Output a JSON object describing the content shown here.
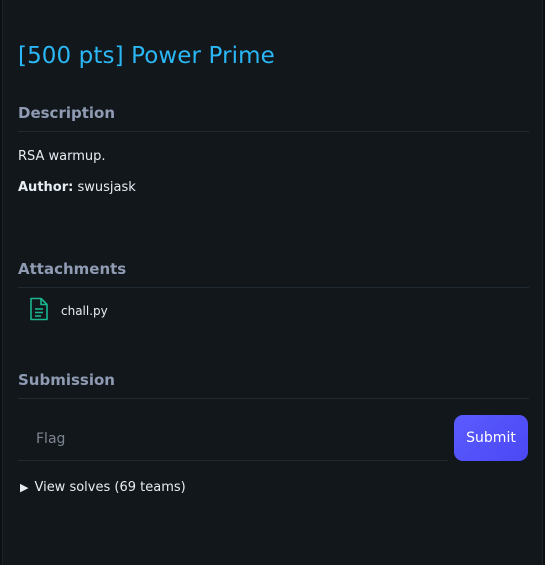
{
  "challenge": {
    "title": "[500 pts] Power Prime",
    "description": "RSA warmup.",
    "author_label": "Author:",
    "author_name": "swusjask"
  },
  "sections": {
    "description": "Description",
    "attachments": "Attachments",
    "submission": "Submission"
  },
  "attachments": [
    {
      "name": "chall.py",
      "icon": "file-document-icon"
    }
  ],
  "submission": {
    "input_placeholder": "Flag",
    "submit_label": "Submit"
  },
  "solves": {
    "label": "View solves (69 teams)",
    "icon": "triangle-right-icon"
  },
  "colors": {
    "accent": "#2bb7f5",
    "button": "#5456ff",
    "file_icon": "#1bb58f",
    "background": "#11171b"
  }
}
